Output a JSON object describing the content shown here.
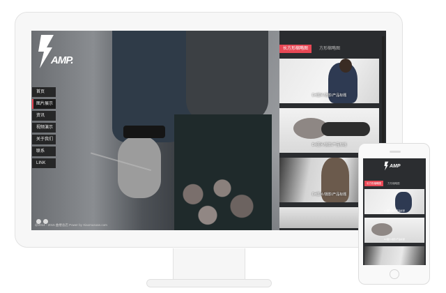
{
  "brand": {
    "logo_text": "AMP."
  },
  "nav": {
    "items": [
      "首页",
      "图片展示",
      "资讯",
      "视频演示",
      "关于我们",
      "联系",
      "LINK"
    ],
    "active_index": 1
  },
  "tabs": {
    "active": "长方形缩略图",
    "inactive": "方形缩略图"
  },
  "gallery": {
    "items": [
      {
        "caption": "Drt图片/摄影/产品标题"
      },
      {
        "caption": "Drt图片/摄影/产品标题"
      },
      {
        "caption": "Drt图片/摄影/产品标题"
      },
      {
        "caption": ""
      }
    ]
  },
  "footer": {
    "copyright": "@2014 - 2015 曲楼总店 Power by Xiaomusoan.com"
  },
  "mobile": {
    "logo_text": "AMP",
    "tab_active": "长方形缩略图",
    "tab_inactive": "方形缩略图",
    "captions": [
      "Drt图片/摄影/产品标题",
      "Drt图片/摄影/产品标题",
      ""
    ]
  },
  "colors": {
    "accent": "#e84855",
    "panel_bg": "#2a2c2f",
    "nav_bg": "#191919"
  },
  "icons": {
    "logo": "lightning-bolt-icon",
    "social": [
      "weibo-icon",
      "twitter-icon"
    ]
  }
}
